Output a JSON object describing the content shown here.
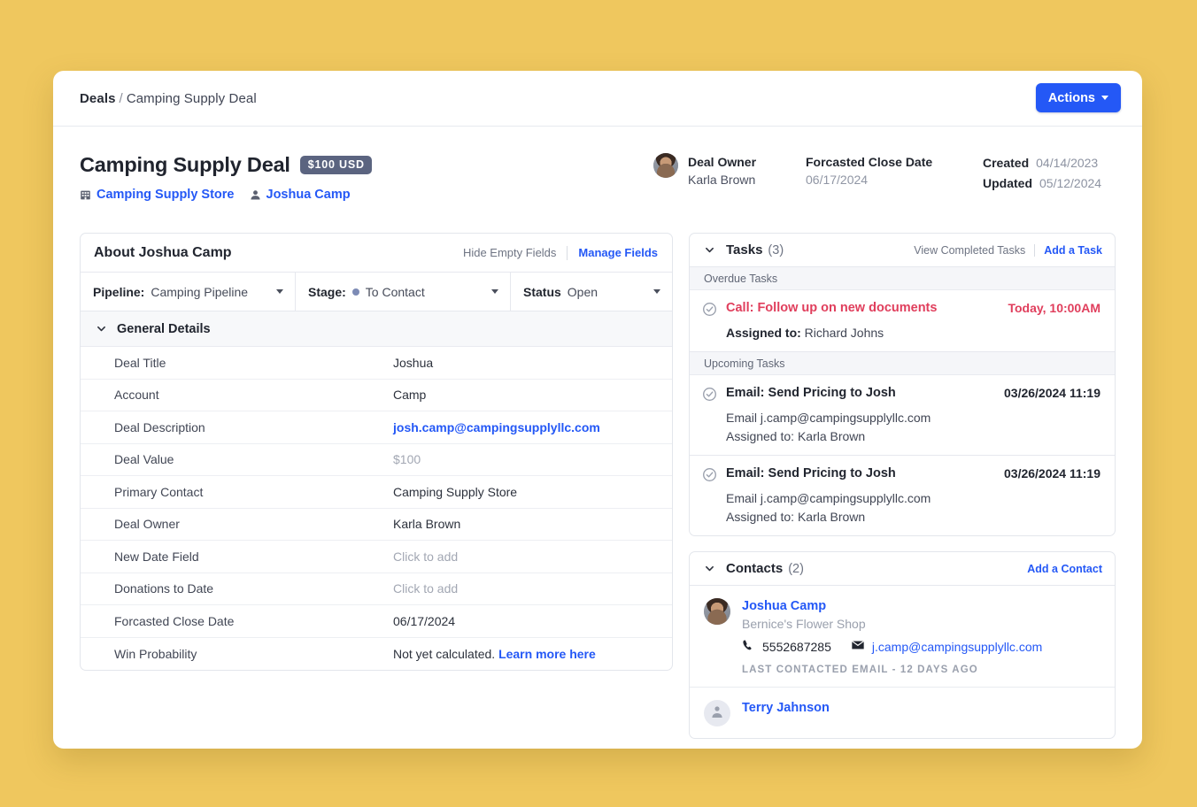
{
  "topbar": {
    "breadcrumb_root": "Deals",
    "breadcrumb_sep": "/",
    "breadcrumb_leaf": "Camping Supply Deal",
    "actions_label": "Actions"
  },
  "record_header": {
    "title": "Camping Supply Deal",
    "amount_badge": "$100 USD",
    "company_link": "Camping Supply Store",
    "contact_link": "Joshua Camp",
    "owner_label": "Deal Owner",
    "owner_name": "Karla Brown",
    "close_date_label": "Forcasted Close Date",
    "close_date_value": "06/17/2024",
    "created_label": "Created",
    "created_value": "04/14/2023",
    "updated_label": "Updated",
    "updated_value": "05/12/2024"
  },
  "about": {
    "title": "About Joshua Camp",
    "hide_empty_fields": "Hide Empty Fields",
    "manage_fields": "Manage Fields",
    "selectors": [
      {
        "key": "Pipeline:",
        "value": "Camping Pipeline",
        "dot": false
      },
      {
        "key": "Stage:",
        "value": "To Contact",
        "dot": true
      },
      {
        "key": "Status",
        "value": "Open",
        "dot": false
      }
    ],
    "section_title": "General Details",
    "fields": [
      {
        "label": "Deal Title",
        "value": "Joshua",
        "style": "plain"
      },
      {
        "label": "Account",
        "value": "Camp",
        "style": "plain"
      },
      {
        "label": "Deal Description",
        "value": "josh.camp@campingsupplyllc.com",
        "style": "link"
      },
      {
        "label": "Deal Value",
        "value": "$100",
        "style": "muted"
      },
      {
        "label": "Primary Contact",
        "value": "Camping Supply Store",
        "style": "plain"
      },
      {
        "label": "Deal Owner",
        "value": "Karla Brown",
        "style": "plain"
      },
      {
        "label": "New Date Field",
        "value": "Click to add",
        "style": "muted"
      },
      {
        "label": "Donations to Date",
        "value": "Click to add",
        "style": "muted"
      },
      {
        "label": "Forcasted Close Date",
        "value": "06/17/2024",
        "style": "plain"
      },
      {
        "label": "Win Probability",
        "value": "Not yet calculated.",
        "style": "split",
        "link_text": "Learn more here"
      }
    ]
  },
  "tasks": {
    "title": "Tasks",
    "count": "(3)",
    "view_completed": "View Completed Tasks",
    "add_task": "Add a Task",
    "overdue_group": "Overdue Tasks",
    "upcoming_group": "Upcoming Tasks",
    "overdue": [
      {
        "title": "Call: Follow up on new documents",
        "due": "Today, 10:00AM",
        "assigned_key": "Assigned to:",
        "assigned_value": "Richard Johns"
      }
    ],
    "upcoming": [
      {
        "title": "Email: Send Pricing to Josh",
        "due": "03/26/2024 11:19",
        "detail": "Email j.camp@campingsupplyllc.com",
        "assigned_key": "Assigned to:",
        "assigned_value": "Karla Brown"
      },
      {
        "title": "Email: Send Pricing to Josh",
        "due": "03/26/2024 11:19",
        "detail": "Email j.camp@campingsupplyllc.com",
        "assigned_key": "Assigned to:",
        "assigned_value": "Karla Brown"
      }
    ]
  },
  "contacts": {
    "title": "Contacts",
    "count": "(2)",
    "add_contact": "Add a Contact",
    "items": [
      {
        "name": "Joshua Camp",
        "org": "Bernice's Flower Shop",
        "phone": "5552687285",
        "email": "j.camp@campingsupplyllc.com",
        "meta": "LAST CONTACTED EMAIL - 12 DAYS AGO"
      },
      {
        "name": "Terry Jahnson"
      }
    ]
  },
  "colors": {
    "page_background": "#efc75e",
    "accent_blue": "#2458f6",
    "badge_slate": "#5b6480",
    "overdue_red": "#e03e5c",
    "stage_dot": "#7d8bb5"
  }
}
